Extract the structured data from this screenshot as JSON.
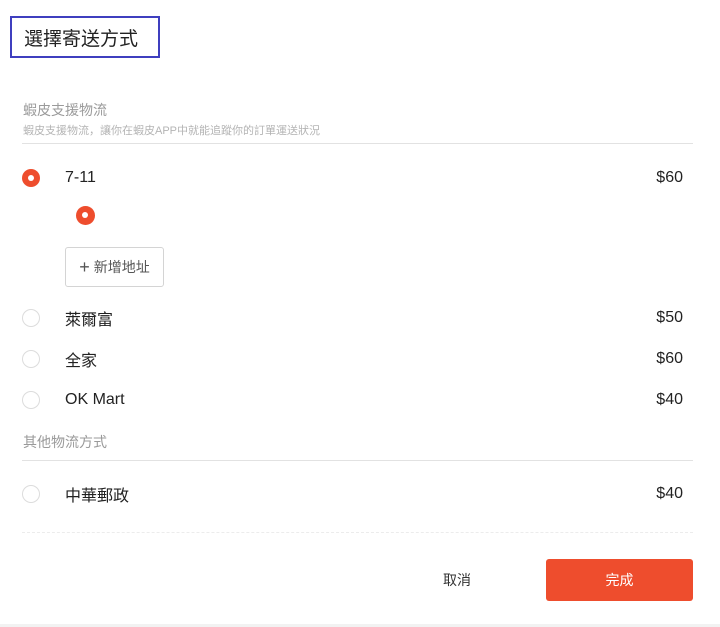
{
  "dialog": {
    "title": "選擇寄送方式"
  },
  "shopee_section": {
    "heading": "蝦皮支援物流",
    "subheading": "蝦皮支援物流，讓你在蝦皮APP中就能追蹤你的訂單運送狀況"
  },
  "shipping_options": [
    {
      "name": "7-11",
      "price": "$60",
      "selected": true
    },
    {
      "name": "萊爾富",
      "price": "$50",
      "selected": false
    },
    {
      "name": "全家",
      "price": "$60",
      "selected": false
    },
    {
      "name": "OK Mart",
      "price": "$40",
      "selected": false
    }
  ],
  "add_address": {
    "label": "新增地址",
    "icon": "plus-icon"
  },
  "other_section": {
    "heading": "其他物流方式"
  },
  "other_options": [
    {
      "name": "中華郵政",
      "price": "$40",
      "selected": false
    }
  ],
  "footer": {
    "cancel_label": "取消",
    "done_label": "完成"
  },
  "colors": {
    "accent": "#ee4d2d",
    "title_border": "#3f3fbf"
  }
}
